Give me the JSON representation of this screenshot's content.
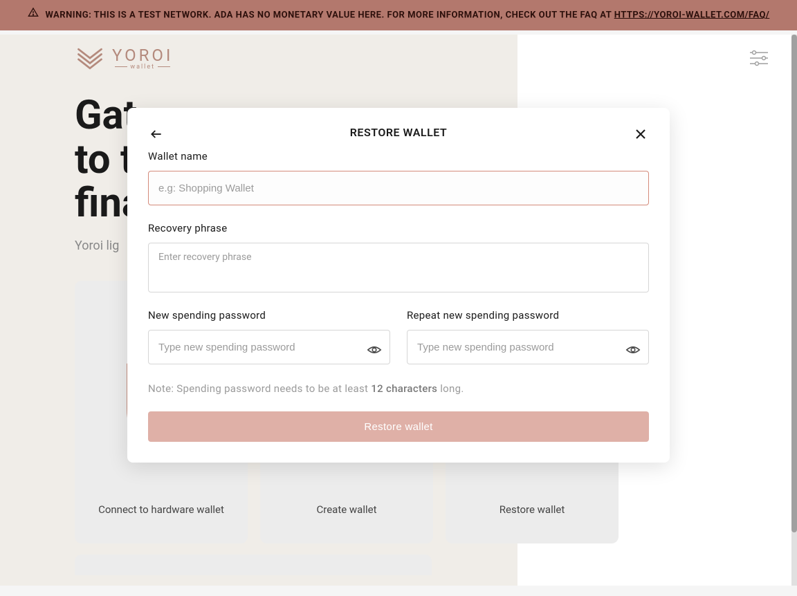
{
  "warning": {
    "prefix": "WARNING: THIS IS A TEST NETWORK. ADA HAS NO MONETARY VALUE HERE. FOR MORE INFORMATION, CHECK OUT THE FAQ AT ",
    "link_text": "HTTPS://YOROI-WALLET.COM/FAQ/"
  },
  "brand": {
    "name": "YOROI",
    "sub": "wallet"
  },
  "hero": {
    "title_line1": "Gat",
    "title_line2": "to t",
    "title_line3": "fina",
    "subtitle": "Yoroi lig"
  },
  "cards": {
    "hardware": "Connect to hardware wallet",
    "create": "Create wallet",
    "restore": "Restore wallet"
  },
  "modal": {
    "title": "RESTORE WALLET",
    "wallet_name_label": "Wallet name",
    "wallet_name_placeholder": "e.g: Shopping Wallet",
    "recovery_label": "Recovery phrase",
    "recovery_placeholder": "Enter recovery phrase",
    "new_pw_label": "New spending password",
    "new_pw_placeholder": "Type new spending password",
    "repeat_pw_label": "Repeat new spending password",
    "repeat_pw_placeholder": "Type new spending password",
    "note_prefix": "Note: Spending password needs to be at least ",
    "note_strong": "12 characters",
    "note_suffix": " long.",
    "submit": "Restore wallet"
  }
}
